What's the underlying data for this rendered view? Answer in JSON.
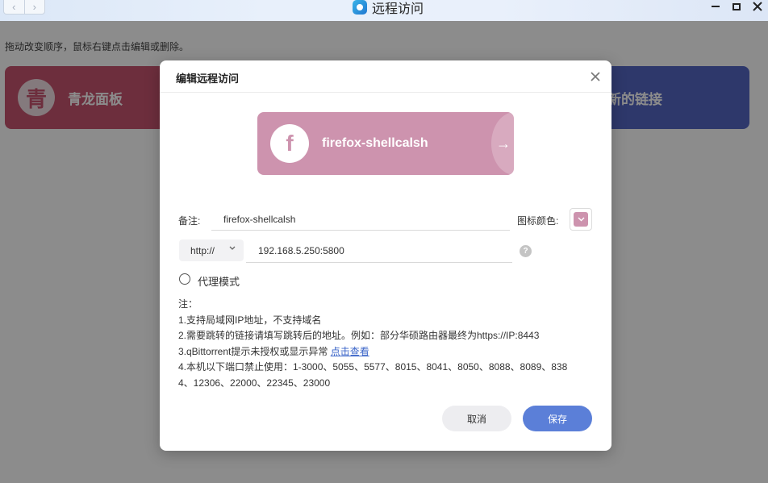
{
  "window": {
    "title": "远程访问",
    "nav_back": "‹",
    "nav_forward": "›"
  },
  "background": {
    "hint": "拖动改变顺序，鼠标右键点击编辑或删除。",
    "tiles": [
      {
        "label": "青龙面板",
        "icon_char": "青",
        "color": "#c6546f"
      },
      {
        "label": "新的链接",
        "color": "#5566c4"
      }
    ]
  },
  "dialog": {
    "title": "编辑远程访问",
    "close": "×",
    "preview": {
      "label": "firefox-shellcalsh",
      "icon_char": "f",
      "arrow": "→",
      "color": "#cd93ae"
    },
    "remark_label": "备注:",
    "remark_value": "firefox-shellcalsh",
    "color_label": "图标颜色:",
    "color_value": "#cd93ae",
    "protocol": "http://",
    "address": "192.168.5.250:5800",
    "help": "?",
    "proxy_label": "代理模式",
    "notes": {
      "heading": "注：",
      "line1": "1.支持局域网IP地址，不支持域名",
      "line2": "2.需要跳转的链接请填写跳转后的地址。例如：部分华硕路由器最终为https://IP:8443",
      "line3": "3.qBittorrent提示未授权或显示异常 ",
      "line3_link": "点击查看",
      "line4a": "4.本机以下端口禁止使用：1-3000、5055、5577、8015、8041、8050、8088、8089、838",
      "line4b": "4、12306、22000、22345、23000"
    },
    "cancel": "取消",
    "save": "保存"
  }
}
